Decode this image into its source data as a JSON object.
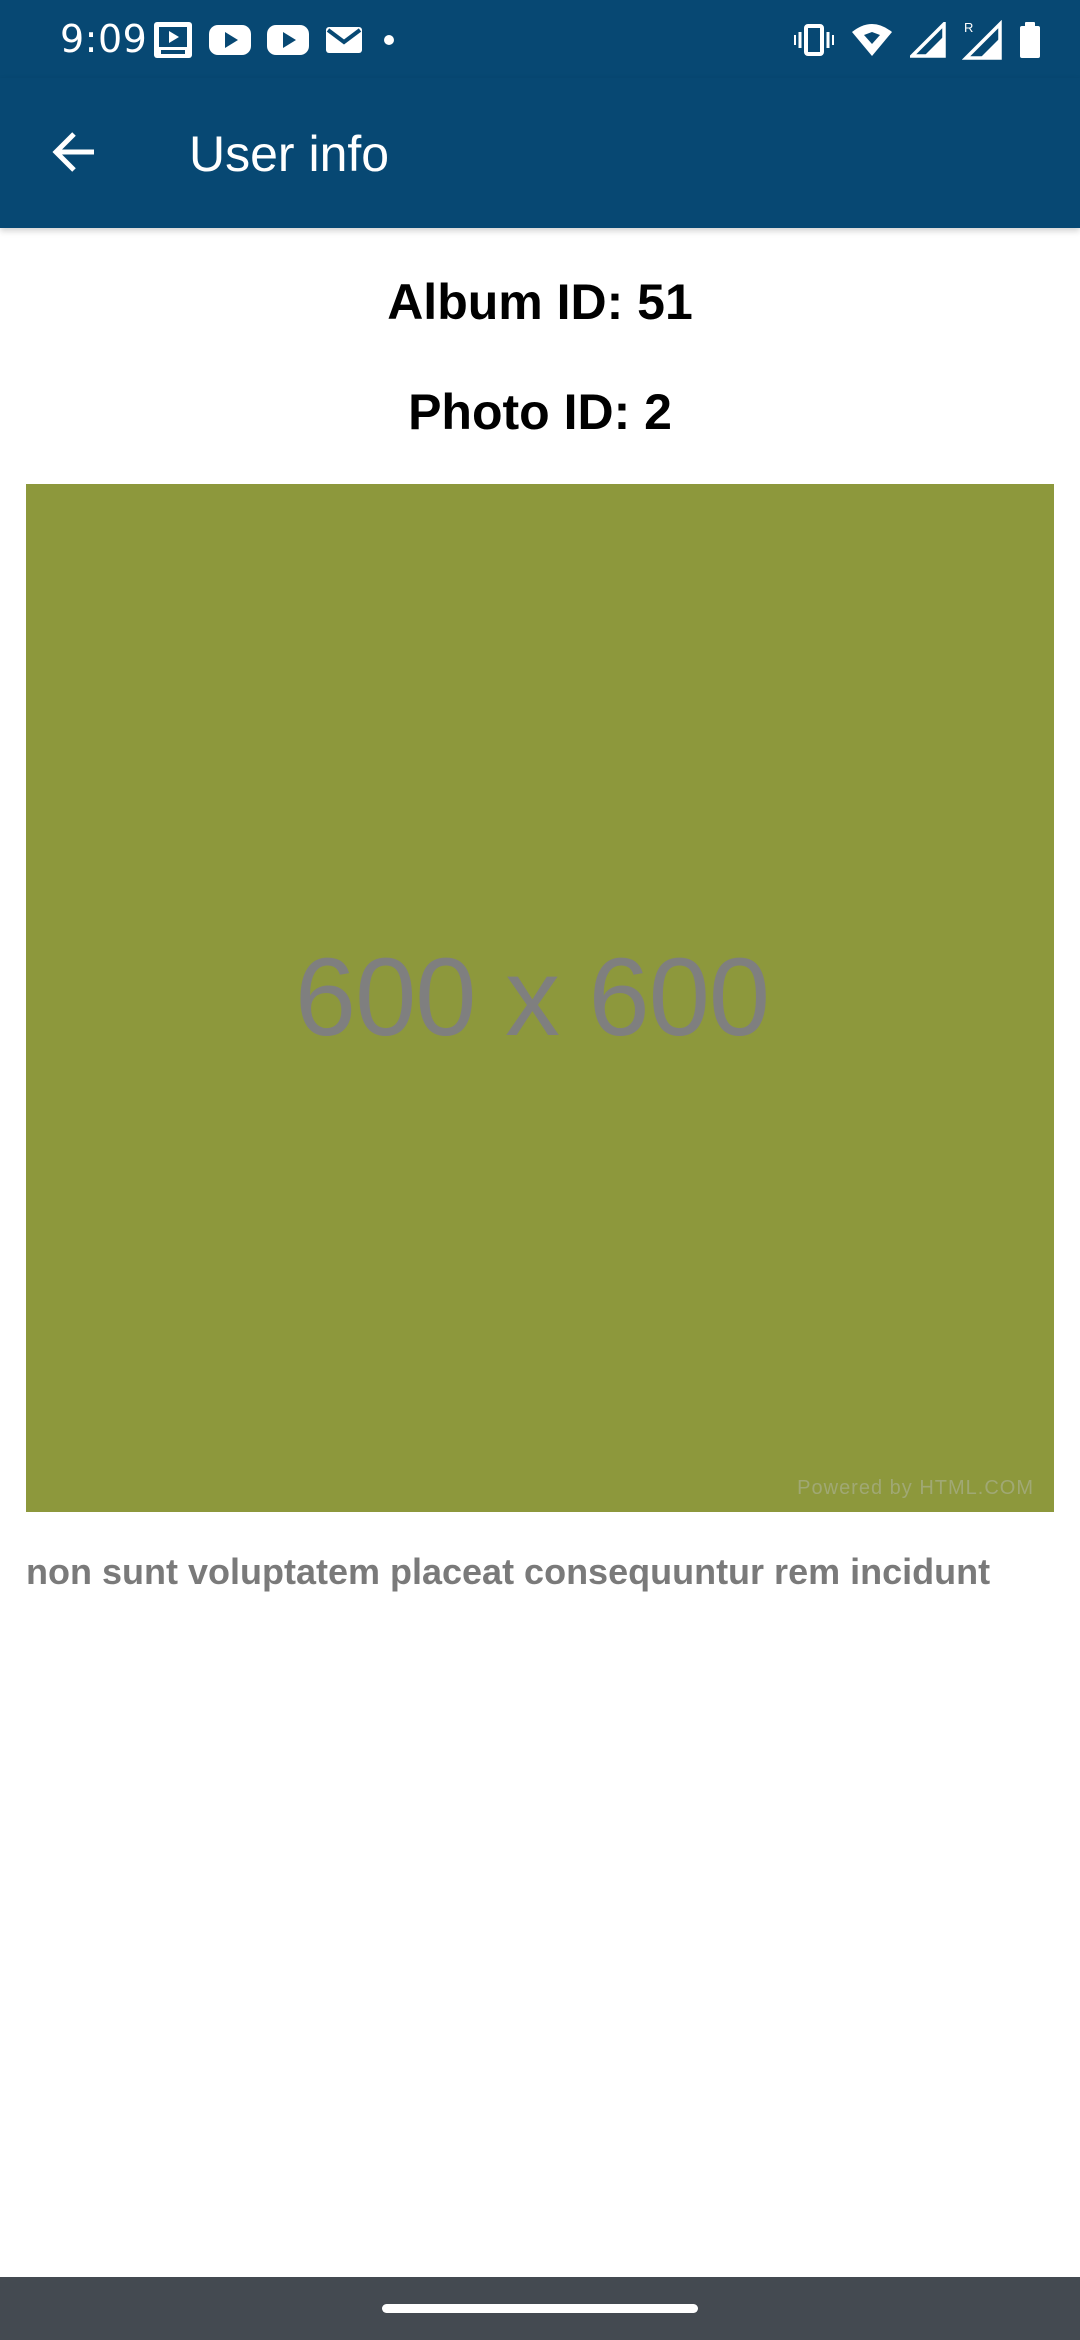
{
  "status_bar": {
    "time": "9:09",
    "left_icons": [
      "media-icon",
      "youtube-icon",
      "youtube-icon",
      "gmail-icon",
      "dot-icon"
    ],
    "right_icons": [
      "vibrate-icon",
      "wifi-icon",
      "signal-icon",
      "signal-roaming-icon",
      "battery-icon"
    ]
  },
  "app_bar": {
    "title": "User info",
    "back_icon": "arrow-back-icon"
  },
  "detail": {
    "album_id": "Album ID: 51",
    "photo_id": "Photo ID: 2",
    "image_size_text": "600 x 600",
    "image_powered_text": "Powered by HTML.COM",
    "caption": "non sunt voluptatem placeat consequuntur rem incidunt"
  },
  "colors": {
    "primary": "#074873",
    "photo_bg": "#8d983c",
    "caption_text": "#7a7a7a",
    "nav_bar": "#444a51"
  }
}
